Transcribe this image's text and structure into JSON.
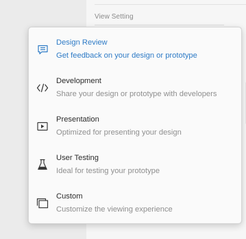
{
  "panel": {
    "section_label": "View Setting"
  },
  "menu": {
    "items": [
      {
        "title": "Design Review",
        "description": "Get feedback on your design or prototype",
        "icon": "comment-icon",
        "active": true
      },
      {
        "title": "Development",
        "description": "Share your design or prototype with developers",
        "icon": "code-icon",
        "active": false
      },
      {
        "title": "Presentation",
        "description": "Optimized for presenting your design",
        "icon": "play-icon",
        "active": false
      },
      {
        "title": "User Testing",
        "description": "Ideal for testing your prototype",
        "icon": "flask-icon",
        "active": false
      },
      {
        "title": "Custom",
        "description": "Customize the viewing experience",
        "icon": "windows-icon",
        "active": false
      }
    ]
  },
  "colors": {
    "accent": "#2e7bc6"
  }
}
